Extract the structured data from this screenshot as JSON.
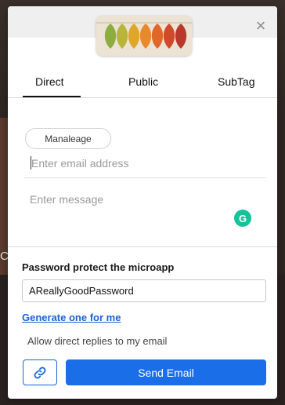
{
  "background": {
    "partial_text": "C"
  },
  "header": {
    "close_symbol": "×"
  },
  "tabs": [
    {
      "label": "Direct",
      "active": true
    },
    {
      "label": "Public",
      "active": false
    },
    {
      "label": "SubTag",
      "active": false
    }
  ],
  "direct": {
    "recipient_chip": "Manaleage",
    "email_placeholder": "Enter email address",
    "message_placeholder": "Enter message",
    "grammarly_letter": "G"
  },
  "password": {
    "label": "Password protect the microapp",
    "value": "AReallyGoodPassword",
    "generate_link": "Generate one for me",
    "allow_replies_label": "Allow direct replies to my email"
  },
  "actions": {
    "send_label": "Send Email"
  },
  "colors": {
    "accent": "#1a6ee8",
    "link": "#1a63d6",
    "grammarly": "#15c39a",
    "header_bg": "#efefef"
  },
  "icons": [
    "close-icon",
    "leaves-thumbnail",
    "grammarly-icon",
    "link-icon"
  ]
}
